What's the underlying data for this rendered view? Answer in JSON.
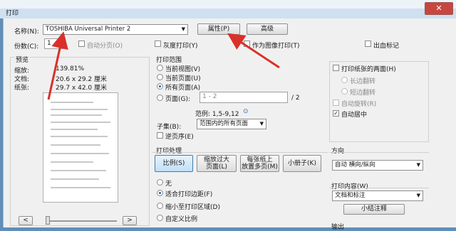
{
  "window": {
    "title": "打印",
    "close_glyph": "✕"
  },
  "printer": {
    "name_label": "名称(N):",
    "selected_printer": "TOSHIBA Universal Printer 2",
    "properties_button": "属性(P)",
    "advanced_button": "高级"
  },
  "copies": {
    "label": "份数(C):",
    "value": "1",
    "collate_label": "自动分页(O)",
    "grayscale_label": "灰度打印(Y)",
    "print_as_image_label": "作为图像打印(T)",
    "ink_label": "出血标记"
  },
  "preview": {
    "section_label": "预览",
    "zoom_label": "缩放:",
    "zoom_value": "139.81%",
    "doc_label": "文档:",
    "doc_value": "20.6 x 29.2 厘米",
    "paper_label": "纸张:",
    "paper_value": "29.7 x 42.0 厘米",
    "prev_button": "<",
    "next_button": ">"
  },
  "range": {
    "section_label": "打印范围",
    "current_view": "当前视图(V)",
    "current_page": "当前页面(U)",
    "all_pages": "所有页面(A)",
    "pages": "页面(G):",
    "pages_value": "1 - 2",
    "pages_total": "/ 2",
    "example": "范例: 1,5-9,12",
    "info_glyph": "⊙",
    "subset_label": "子集(B):",
    "subset_value": "范围内的所有页面",
    "reverse_label": "逆页序(E)"
  },
  "handling": {
    "section_label": "打印处理",
    "scale_tab": "比例(S)",
    "shrink_tab_line1": "缩放过大",
    "shrink_tab_line2": "页面(L)",
    "multiple_tab_line1": "每张纸上",
    "multiple_tab_line2": "放置多页(M)",
    "booklet_tab": "小册子(K)",
    "none": "无",
    "fit": "适合打印边距(F)",
    "shrink": "缩小至打印区域(D)",
    "custom": "自定义比例"
  },
  "duplex": {
    "both_sides": "打印纸张的两面(H)",
    "long_edge": "长边翻转",
    "short_edge": "短边翻转",
    "auto_rotate": "自动旋转(R)",
    "auto_center": "自动居中"
  },
  "orientation": {
    "section_label": "方向",
    "value": "自动 横向/纵向"
  },
  "content": {
    "section_label": "打印内容(W)",
    "value": "文档和标注",
    "summary_button": "小结注释"
  },
  "output": {
    "section_label": "输出"
  },
  "colors": {
    "arrow": "#d9302a",
    "accent": "#3c7fb1"
  }
}
